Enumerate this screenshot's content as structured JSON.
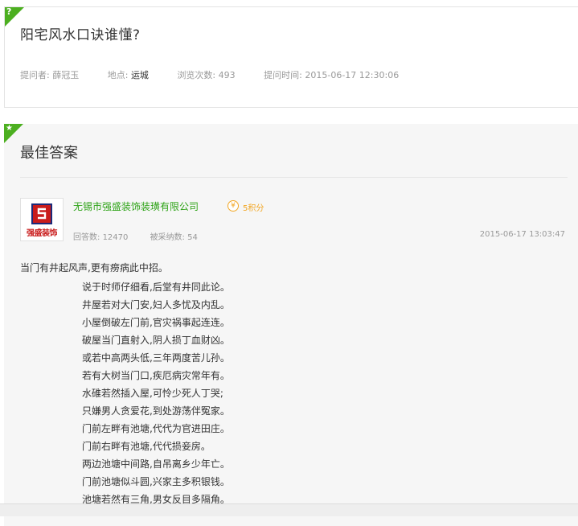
{
  "question": {
    "corner_glyph": "?",
    "title": "阳宅风水口诀谁懂?",
    "asker_label": "提问者:",
    "asker": "薛冠玉",
    "location_label": "地点:",
    "location": "运城",
    "views_label": "浏览次数:",
    "views": "493",
    "time_label": "提问时间:",
    "time": "2015-06-17 12:30:06"
  },
  "answer": {
    "corner_glyph": "★",
    "heading": "最佳答案",
    "avatar_text": "强盛装饰",
    "company": "无锡市强盛装饰装璜有限公司",
    "points_icon": "¥",
    "points": "5积分",
    "replies_label": "回答数:",
    "replies": "12470",
    "adopted_label": "被采纳数:",
    "adopted": "54",
    "time": "2015-06-17 13:03:47",
    "lead": "当门有井起风声,更有痨病此中招。",
    "lines": [
      "说于时师仔细看,后堂有井同此论。",
      "井屋若对大门安,妇人多忧及内乱。",
      "小屋倒破左门前,官灾祸事起连连。",
      "破屋当门直射入,阴人损丁血财凶。",
      "或若中高两头低,三年两度苦儿孙。",
      "若有大树当门口,疾厄病灾常年有。",
      "水碓若然插入屋,可怜少死人丁哭;",
      "只嫌男人贪爱花,到处游荡伴冤家。",
      "门前左畔有池塘,代代为官进田庄。",
      "门前右畔有池塘,代代损妾房。",
      "两边池塘中间路,自吊离乡少年亡。",
      "门前池塘似斗圆,兴家主多积银钱。",
      "池塘若然有三角,男女反目多隔角。"
    ]
  },
  "colors": {
    "accent_green": "#4caf20",
    "link_green": "#2ea317",
    "points_orange": "#f2a623"
  }
}
